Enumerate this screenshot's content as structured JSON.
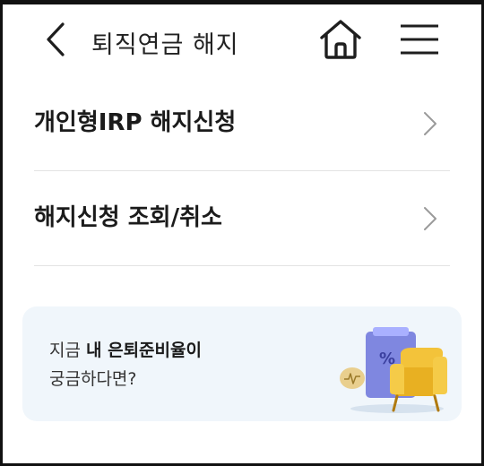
{
  "header": {
    "title": "퇴직연금 해지",
    "back_icon": "chevron-left-icon",
    "home_icon": "home-icon",
    "menu_icon": "hamburger-menu-icon"
  },
  "menu": {
    "items": [
      {
        "label": "개인형IRP 해지신청",
        "icon": "chevron-right-icon"
      },
      {
        "label": "해지신청 조회/취소",
        "icon": "chevron-right-icon"
      }
    ]
  },
  "banner": {
    "line1_prefix": "지금 ",
    "line1_bold": "내 은퇴준비율이",
    "line2": "궁금하다면?",
    "illustration": "armchair-percent-illustration",
    "colors": {
      "background": "#f0f6fb",
      "chair": "#f3c33a",
      "board": "#7f87e0"
    }
  }
}
